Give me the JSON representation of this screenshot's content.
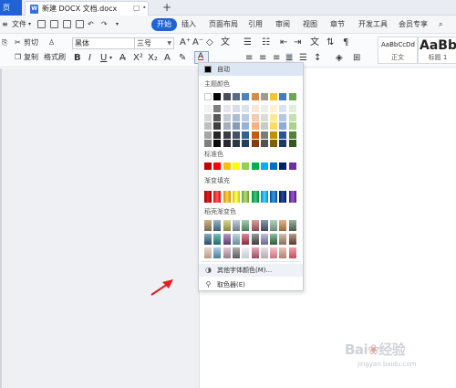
{
  "titlebar": {
    "home_tab": "页",
    "doc_tab": "新建 DOCX 文档.docx",
    "doc_icon": "W",
    "new_tab": "+"
  },
  "menubar": {
    "file": "文件",
    "items": [
      "开始",
      "插入",
      "页面布局",
      "引用",
      "审阅",
      "视图",
      "章节",
      "开发工具",
      "会员专享"
    ],
    "search_icon": "search-icon"
  },
  "ribbon": {
    "cut": "剪切",
    "copy": "复制",
    "format_painter": "格式刷",
    "font_name": "黑体",
    "font_size": "三号",
    "bold": "B",
    "italic": "I",
    "underline": "U",
    "font_color_button": "A",
    "styles": [
      {
        "sample": "AaBbCcDd",
        "name": "正文"
      },
      {
        "sample": "AaBb",
        "name": "标题 1"
      }
    ]
  },
  "dropdown": {
    "auto": "自动",
    "theme_colors": "主题颜色",
    "standard_colors": "标准色",
    "gradient_fill": "渐变填充",
    "shell_gradient": "稻壳渐变色",
    "more_colors": "其他字体颜色(M)...",
    "eyedropper": "取色器(E)",
    "theme_top_row": [
      "#ffffff",
      "#000000",
      "#4a4f57",
      "#5a6a7f",
      "#4f81bd",
      "#d68a42",
      "#9b9b9b",
      "#f5c231",
      "#4a79c0",
      "#6aa84f"
    ],
    "theme_shade_rows": [
      [
        "#f2f2f2",
        "#7f7f7f",
        "#e3e6ea",
        "#d6dee8",
        "#dbe5f1",
        "#fbe5d6",
        "#ededed",
        "#fff2cc",
        "#dae3f3",
        "#e2efda"
      ],
      [
        "#d8d8d8",
        "#595959",
        "#c5cad3",
        "#acbdd1",
        "#b8cce4",
        "#f7cbad",
        "#dbdbdb",
        "#ffe699",
        "#b4c7e7",
        "#c6e0b4"
      ],
      [
        "#bfbfbf",
        "#3f3f3f",
        "#a8afbb",
        "#849cba",
        "#95b3d7",
        "#f4b183",
        "#c9c9c9",
        "#ffd966",
        "#8eaadb",
        "#a9d18e"
      ],
      [
        "#a5a5a5",
        "#262626",
        "#3a3e44",
        "#435164",
        "#366092",
        "#c55a11",
        "#7b7b7b",
        "#bf9000",
        "#2f5597",
        "#538135"
      ],
      [
        "#7f7f7f",
        "#0c0c0c",
        "#272a2e",
        "#2d3643",
        "#244061",
        "#833c0b",
        "#525252",
        "#7f6000",
        "#1f3864",
        "#375623"
      ]
    ],
    "standard": [
      "#c00000",
      "#ff0000",
      "#ffc000",
      "#ffff00",
      "#92d050",
      "#00b050",
      "#00b0f0",
      "#0070c0",
      "#002060",
      "#7030a0"
    ],
    "gradients": [
      [
        "#a00000",
        "#e02020"
      ],
      [
        "#d01010",
        "#ff5a5a"
      ],
      [
        "#d09000",
        "#ffd24a"
      ],
      [
        "#c8c800",
        "#ffff66"
      ],
      [
        "#6aa030",
        "#b4e07a"
      ],
      [
        "#008a40",
        "#3ccb7a"
      ],
      [
        "#008ec0",
        "#4fd0ff"
      ],
      [
        "#00509a",
        "#3a96e0"
      ],
      [
        "#001a50",
        "#2a4a9a"
      ],
      [
        "#4a1a80",
        "#9a5ad0"
      ]
    ],
    "shell_rows": [
      [
        [
          "#7a6a4a",
          "#c9b48a"
        ],
        [
          "#3a5a7a",
          "#9ab8d0"
        ],
        [
          "#8a8a3a",
          "#d8d89a"
        ],
        [
          "#6a7a8a",
          "#c8d0d8"
        ],
        [
          "#4a7a5a",
          "#a8d0b0"
        ],
        [
          "#8a4a4a",
          "#d8a0a0"
        ],
        [
          "#3a4a5a",
          "#8a9aaa"
        ],
        [
          "#6a8a7a",
          "#b8d0c0"
        ],
        [
          "#9a6a3a",
          "#e0b890"
        ],
        [
          "#4a5a4a",
          "#a0b0a0"
        ]
      ],
      [
        [
          "#2a4a6a",
          "#8aaac8"
        ],
        [
          "#1a6a6a",
          "#7ac0c0"
        ],
        [
          "#5a3a6a",
          "#b89ac8"
        ],
        [
          "#6a8a9a",
          "#c0d8e0"
        ],
        [
          "#8a2a3a",
          "#e08a9a"
        ],
        [
          "#3a3a3a",
          "#9a9a9a"
        ],
        [
          "#6a6a8a",
          "#c0c0d8"
        ],
        [
          "#2a5a3a",
          "#8ac0a0"
        ],
        [
          "#8a6a5a",
          "#d8c0b0"
        ],
        [
          "#5a3a2a",
          "#b89a8a"
        ]
      ],
      [
        [
          "#b89a8a",
          "#e8d8d0"
        ],
        [
          "#4a7a9a",
          "#a8d0e8"
        ],
        [
          "#9a7a8a",
          "#e0c8d8"
        ],
        [
          "#5a5a5a",
          "#b0b0b0"
        ],
        [
          "#c8c8d0",
          "#f0f0f4"
        ],
        [
          "#9a4a5a",
          "#e8a8b8"
        ],
        [
          "#b8a8b0",
          "#e8e0e4"
        ],
        [
          "#d07080",
          "#f8c0c8"
        ],
        [
          "#b08070",
          "#e8c8b8"
        ],
        [
          "#c05060",
          "#f0a0b0"
        ]
      ]
    ]
  }
}
